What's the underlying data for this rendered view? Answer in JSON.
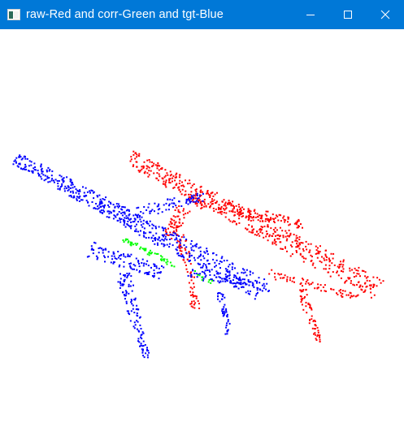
{
  "window": {
    "title": "raw-Red and corr-Green and tgt-Blue",
    "titlebar_color": "#0078d7",
    "title_color": "#ffffff",
    "canvas_color": "#ffffff"
  },
  "controls": {
    "minimize_icon": "minimize-icon",
    "maximize_icon": "maximize-icon",
    "close_icon": "close-icon"
  },
  "point_clouds": {
    "raw": {
      "color": "#ff0000"
    },
    "corr": {
      "color": "#00ff00"
    },
    "tgt": {
      "color": "#0000ff"
    }
  }
}
